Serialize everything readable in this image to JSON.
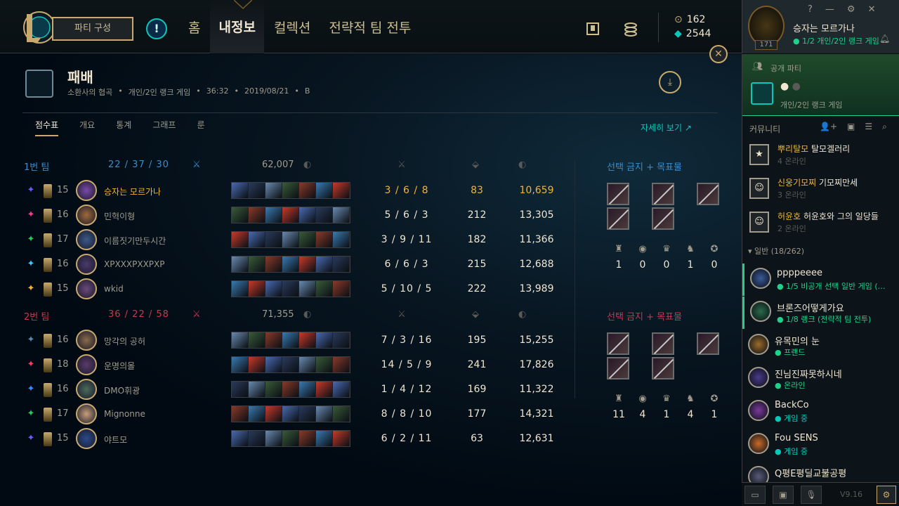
{
  "topbar": {
    "party_button": "파티 구성",
    "nav": [
      "홈",
      "내정보",
      "컬렉션",
      "전략적 팀 전투"
    ],
    "rp": "162",
    "be": "2544"
  },
  "profile": {
    "name": "승자는 모르가나",
    "status": "1/2 개인/2인 랭크 게임",
    "level": "171"
  },
  "match": {
    "result": "패배",
    "map": "소환사의 협곡",
    "queue": "개인/2인 랭크 게임",
    "duration": "36:32",
    "date": "2019/08/21",
    "grade": "B",
    "tabs": [
      "점수표",
      "개요",
      "통계",
      "그래프",
      "룬"
    ],
    "details_link": "자세히 보기 ↗"
  },
  "teams": [
    {
      "name": "1번 팀",
      "kills": "22",
      "deaths": "37",
      "assists": "30",
      "gold": "62,007",
      "color": "#3c8cc8",
      "bans_title": "선택 금지 + 목표물",
      "objectives": [
        "1",
        "0",
        "0",
        "1",
        "0"
      ],
      "players": [
        {
          "level": "15",
          "name": "승자는 모르가나",
          "me": true,
          "kda": "3  /  6  /  8",
          "cs": "83",
          "gold": "10,659"
        },
        {
          "level": "16",
          "name": "민혁이형",
          "kda": "5  /  6  /  3",
          "cs": "212",
          "gold": "13,305"
        },
        {
          "level": "17",
          "name": "이름짓기만두시간",
          "kda": "3  /  9  / 11",
          "cs": "182",
          "gold": "11,366"
        },
        {
          "level": "16",
          "name": "XPXXXPXXPXP",
          "kda": "6  /  6  /  3",
          "cs": "215",
          "gold": "12,688"
        },
        {
          "level": "15",
          "name": "wkid",
          "kda": "5  / 10  /  5",
          "cs": "222",
          "gold": "13,989"
        }
      ]
    },
    {
      "name": "2번 팀",
      "kills": "36",
      "deaths": "22",
      "assists": "58",
      "gold": "71,355",
      "color": "#c8394b",
      "bans_title": "선택 금지 + 목표물",
      "objectives": [
        "11",
        "4",
        "1",
        "4",
        "1"
      ],
      "players": [
        {
          "level": "16",
          "name": "망각의 공허",
          "kda": "7  /  3  / 16",
          "cs": "195",
          "gold": "15,255"
        },
        {
          "level": "18",
          "name": "운명의몰",
          "kda": "14  /  5  /  9",
          "cs": "241",
          "gold": "17,826"
        },
        {
          "level": "16",
          "name": "DMO휘광",
          "kda": "1  /  4  / 12",
          "cs": "169",
          "gold": "11,322"
        },
        {
          "level": "17",
          "name": "Mignonne",
          "kda": "8  /  8  / 10",
          "cs": "177",
          "gold": "14,321"
        },
        {
          "level": "15",
          "name": "야트모",
          "kda": "6  /  2  / 11",
          "cs": "63",
          "gold": "12,631"
        }
      ]
    }
  ],
  "social": {
    "party_title": "공개 파티",
    "party_mode": "개인/2인 랭크 게임",
    "community": "커뮤니티",
    "clubs": [
      {
        "tag": "뿌리탈모",
        "name": "탈모겔러리",
        "online": "4 온라인"
      },
      {
        "tag": "신웅기모찌",
        "name": "기모찌만세",
        "online": "3 온라인"
      },
      {
        "tag": "허윤호",
        "name": "허윤호와 그의 일당들",
        "online": "2 온라인"
      }
    ],
    "group": "일반 (18/262)",
    "friends": [
      {
        "name": "ppppeeee",
        "status": "1/5 비공개 선택 일반 게임 (…",
        "color": "#1fd18b"
      },
      {
        "name": "브론즈어떻게가요",
        "status": "1/8 랭크 (전략적 팀 전투)",
        "color": "#1fd18b"
      },
      {
        "name": "유목민의 눈",
        "status": "프랜드",
        "color": "#1fd18b"
      },
      {
        "name": "진님진짜못하시네",
        "status": "온라인",
        "color": "#1fd18b"
      },
      {
        "name": "BackCo",
        "status": "게임 중",
        "color": "#0ac8b9"
      },
      {
        "name": "Fou SENS",
        "status": "게임 중",
        "color": "#0ac8b9"
      },
      {
        "name": "Q평E평딜교불공평",
        "status": "",
        "color": "#0ac8b9"
      }
    ],
    "version": "V9.16"
  }
}
